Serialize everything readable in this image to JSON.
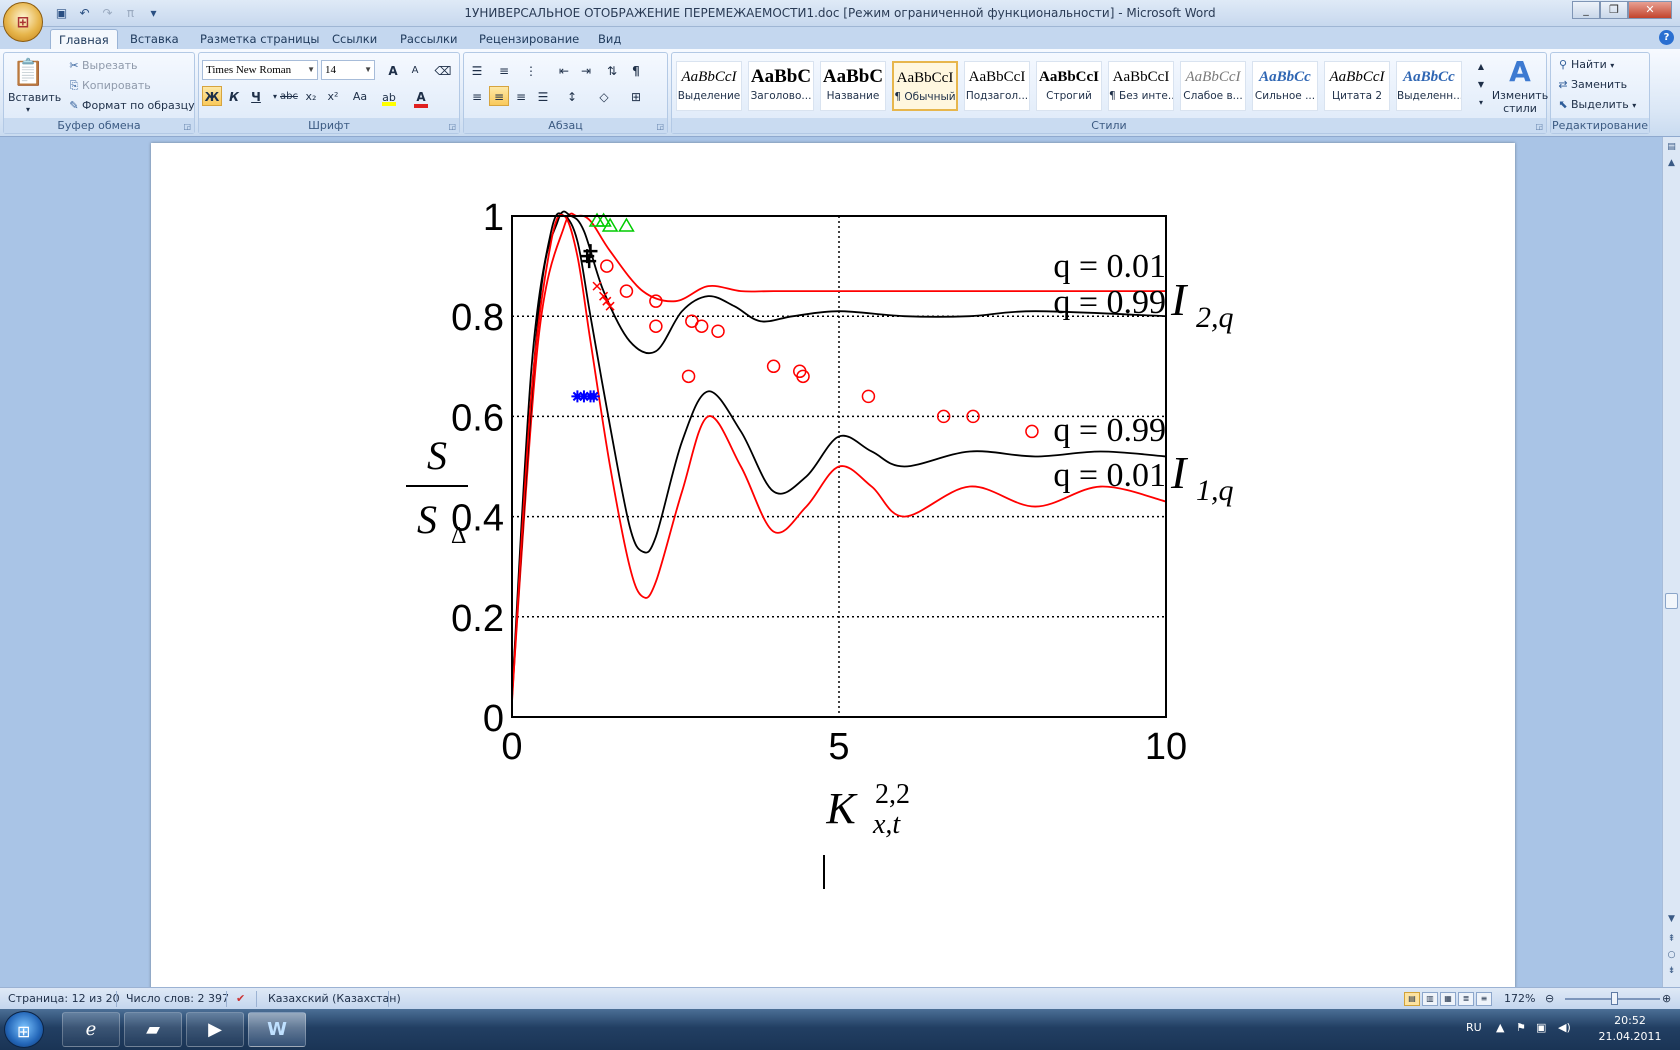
{
  "window": {
    "title": "1УНИВЕРСАЛЬНОЕ ОТОБРАЖЕНИЕ ПЕРЕМЕЖАЕМОСТИ1.doc [Режим ограниченной функциональности] - Microsoft Word",
    "office_button_icon": "office-logo",
    "minimize_icon": "minimize-icon",
    "maximize_icon": "restore-icon",
    "close_icon": "close-icon"
  },
  "quick_access": [
    "save-icon",
    "undo-icon",
    "redo-icon",
    "equation-icon",
    "customize-icon"
  ],
  "tabs": [
    "Главная",
    "Вставка",
    "Разметка страницы",
    "Ссылки",
    "Рассылки",
    "Рецензирование",
    "Вид"
  ],
  "active_tab": "Главная",
  "ribbon": {
    "clipboard": {
      "label": "Буфер обмена",
      "paste": "Вставить",
      "cut": "Вырезать",
      "copy": "Копировать",
      "format_painter": "Формат по образцу"
    },
    "font": {
      "label": "Шрифт",
      "font_name": "Times New Roman",
      "font_size": "14",
      "grow": "A",
      "shrink": "A",
      "bold": "Ж",
      "italic": "К",
      "underline": "Ч",
      "strike": "abc",
      "subscript": "x₂",
      "superscript": "x²",
      "change_case": "Aa",
      "highlight_color": "#ffff00",
      "font_color": "#e02020"
    },
    "paragraph": {
      "label": "Абзац"
    },
    "styles": {
      "label": "Стили",
      "items": [
        {
          "preview": "AaBbCcI",
          "name": "Выделение"
        },
        {
          "preview": "AaBbC",
          "name": "Заголово..."
        },
        {
          "preview": "AaBbC",
          "name": "Название"
        },
        {
          "preview": "AaBbCcI",
          "name": "¶ Обычный"
        },
        {
          "preview": "AaBbCcI",
          "name": "Подзагол..."
        },
        {
          "preview": "AaBbCcI",
          "name": "Строгий"
        },
        {
          "preview": "AaBbCcI",
          "name": "¶ Без инте..."
        },
        {
          "preview": "AaBbCcI",
          "name": "Слабое в..."
        },
        {
          "preview": "AaBbCc",
          "name": "Сильное ..."
        },
        {
          "preview": "AaBbCcI",
          "name": "Цитата 2"
        },
        {
          "preview": "AaBbCc",
          "name": "Выделенн..."
        }
      ],
      "selected_index": 3,
      "change_styles": "Изменить стили"
    },
    "editing": {
      "label": "Редактирование",
      "find": "Найти",
      "replace": "Заменить",
      "select": "Выделить"
    }
  },
  "document": {
    "y_label_num": "S",
    "y_label_den": "S",
    "y_label_den_sub": "Δ",
    "x_label_main": "K",
    "x_label_sup": "2,2",
    "x_label_sub": "x,t",
    "annotations": [
      {
        "text": "q = 0.01"
      },
      {
        "text": "q = 0.99"
      },
      {
        "text": "q = 0.99"
      },
      {
        "text": "q = 0.01"
      }
    ],
    "curve_labels": [
      {
        "main": "I",
        "sub": "2,q"
      },
      {
        "main": "I",
        "sub": "1,q"
      }
    ]
  },
  "chart_data": {
    "type": "line",
    "title": "",
    "xlim": [
      0,
      10
    ],
    "ylim": [
      0,
      1
    ],
    "x_ticks": [
      "0",
      "5",
      "10"
    ],
    "y_ticks": [
      "0",
      "0.2",
      "0.4",
      "0.6",
      "0.8",
      "1"
    ],
    "grid": "dotted",
    "series": [
      {
        "name": "I_{2,q}, q = 0.01",
        "color": "#ff0000",
        "x": [
          0,
          0.4,
          0.8,
          1.0,
          1.2,
          1.5,
          2.0,
          2.5,
          3.0,
          3.5,
          4.0,
          5.0,
          6.0,
          7.0,
          8.0,
          10.0
        ],
        "y": [
          0.04,
          0.75,
          0.98,
          1.0,
          0.99,
          0.93,
          0.85,
          0.83,
          0.86,
          0.85,
          0.85,
          0.85,
          0.85,
          0.85,
          0.85,
          0.85
        ]
      },
      {
        "name": "I_{2,q}, q = 0.99",
        "color": "#000000",
        "x": [
          0,
          0.4,
          0.7,
          0.9,
          1.1,
          1.4,
          1.8,
          2.2,
          2.6,
          3.0,
          3.4,
          3.8,
          4.3,
          5.0,
          6.0,
          7.0,
          8.0,
          10.0
        ],
        "y": [
          0.05,
          0.8,
          0.99,
          1.0,
          0.97,
          0.85,
          0.75,
          0.73,
          0.81,
          0.84,
          0.82,
          0.79,
          0.8,
          0.81,
          0.8,
          0.8,
          0.81,
          0.8
        ]
      },
      {
        "name": "I_{1,q}, q = 0.99",
        "color": "#000000",
        "x": [
          0,
          0.3,
          0.6,
          0.8,
          1.0,
          1.2,
          1.5,
          1.8,
          2.0,
          2.2,
          2.6,
          3.0,
          3.5,
          4.0,
          4.5,
          5.0,
          5.5,
          6.0,
          7.0,
          8.0,
          9.0,
          10.0
        ],
        "y": [
          0.04,
          0.7,
          0.97,
          1.0,
          0.95,
          0.8,
          0.58,
          0.38,
          0.33,
          0.36,
          0.55,
          0.65,
          0.57,
          0.45,
          0.48,
          0.56,
          0.53,
          0.5,
          0.53,
          0.52,
          0.53,
          0.52
        ]
      },
      {
        "name": "I_{1,q}, q = 0.01",
        "color": "#ff0000",
        "x": [
          0,
          0.3,
          0.6,
          0.8,
          1.0,
          1.2,
          1.5,
          1.8,
          2.0,
          2.2,
          2.6,
          3.0,
          3.5,
          4.0,
          4.5,
          5.0,
          5.5,
          6.0,
          7.0,
          8.0,
          9.0,
          10.0
        ],
        "y": [
          0.03,
          0.65,
          0.95,
          1.0,
          0.92,
          0.75,
          0.5,
          0.3,
          0.24,
          0.27,
          0.45,
          0.6,
          0.5,
          0.37,
          0.42,
          0.5,
          0.46,
          0.4,
          0.46,
          0.42,
          0.46,
          0.43
        ]
      }
    ],
    "markers": [
      {
        "symbol": "circle",
        "color": "#ff0000",
        "points": [
          [
            1.45,
            0.9
          ],
          [
            1.75,
            0.85
          ],
          [
            2.2,
            0.83
          ],
          [
            2.2,
            0.78
          ],
          [
            2.7,
            0.68
          ],
          [
            2.75,
            0.79
          ],
          [
            2.9,
            0.78
          ],
          [
            3.15,
            0.77
          ],
          [
            4.0,
            0.7
          ],
          [
            4.4,
            0.69
          ],
          [
            4.45,
            0.68
          ],
          [
            5.45,
            0.64
          ],
          [
            6.6,
            0.6
          ],
          [
            7.05,
            0.6
          ],
          [
            7.95,
            0.57
          ]
        ]
      },
      {
        "symbol": "triangle",
        "color": "#00cc00",
        "points": [
          [
            1.3,
            0.99
          ],
          [
            1.4,
            0.99
          ],
          [
            1.5,
            0.98
          ],
          [
            1.75,
            0.98
          ]
        ]
      },
      {
        "symbol": "plus",
        "color": "#000000",
        "points": [
          [
            1.15,
            0.92
          ],
          [
            1.2,
            0.93
          ],
          [
            1.18,
            0.91
          ]
        ]
      },
      {
        "symbol": "star",
        "color": "#0000ff",
        "points": [
          [
            1.0,
            0.64
          ],
          [
            1.1,
            0.64
          ],
          [
            1.2,
            0.64
          ],
          [
            1.25,
            0.64
          ]
        ]
      },
      {
        "symbol": "x",
        "color": "#ff0000",
        "points": [
          [
            1.3,
            0.86
          ],
          [
            1.4,
            0.84
          ],
          [
            1.45,
            0.83
          ],
          [
            1.5,
            0.82
          ]
        ]
      }
    ]
  },
  "statusbar": {
    "page": "Страница: 12 из 20",
    "words": "Число слов: 2 397",
    "language": "Казахский (Казахстан)",
    "zoom": "172%",
    "zoom_level": 0.72
  },
  "taskbar": {
    "apps": [
      "windows-explorer-icon",
      "internet-explorer-icon",
      "folder-icon",
      "media-player-icon",
      "word-icon"
    ],
    "lang": "RU",
    "time": "20:52",
    "date": "21.04.2011"
  }
}
